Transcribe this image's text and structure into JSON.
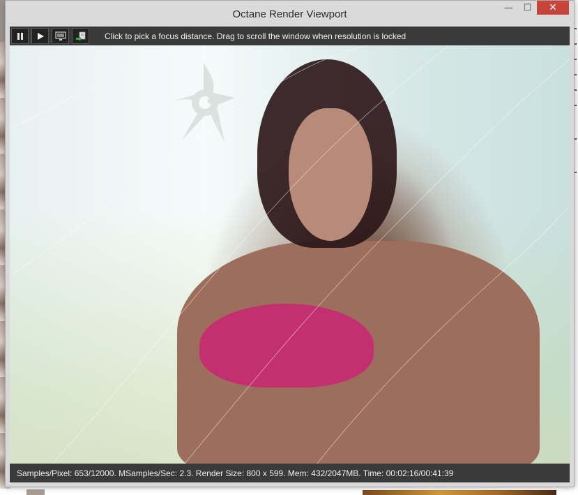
{
  "window": {
    "title": "Octane Render Viewport",
    "minimize_glyph": "—",
    "maximize_glyph": "☐",
    "close_glyph": "✕"
  },
  "toolbar": {
    "buttons": [
      {
        "name": "pause",
        "icon": "pause-icon"
      },
      {
        "name": "play",
        "icon": "play-icon"
      },
      {
        "name": "monitor",
        "icon": "monitor-icon"
      },
      {
        "name": "export",
        "icon": "export-icon"
      }
    ],
    "hint": "Click to pick a focus distance.  Drag to scroll the window when resolution is locked"
  },
  "viewport": {
    "logo": "octane-logo-watermark"
  },
  "status": {
    "text": "Samples/Pixel: 653/12000. MSamples/Sec: 2.3. Render Size: 800 x 599. Mem: 432/2047MB. Time: 00:02:16/00:41:39"
  },
  "colors": {
    "toolbar_bg": "#3a3a3a",
    "close_button": "#c7443a",
    "accent_magenta": "#c3306f"
  }
}
